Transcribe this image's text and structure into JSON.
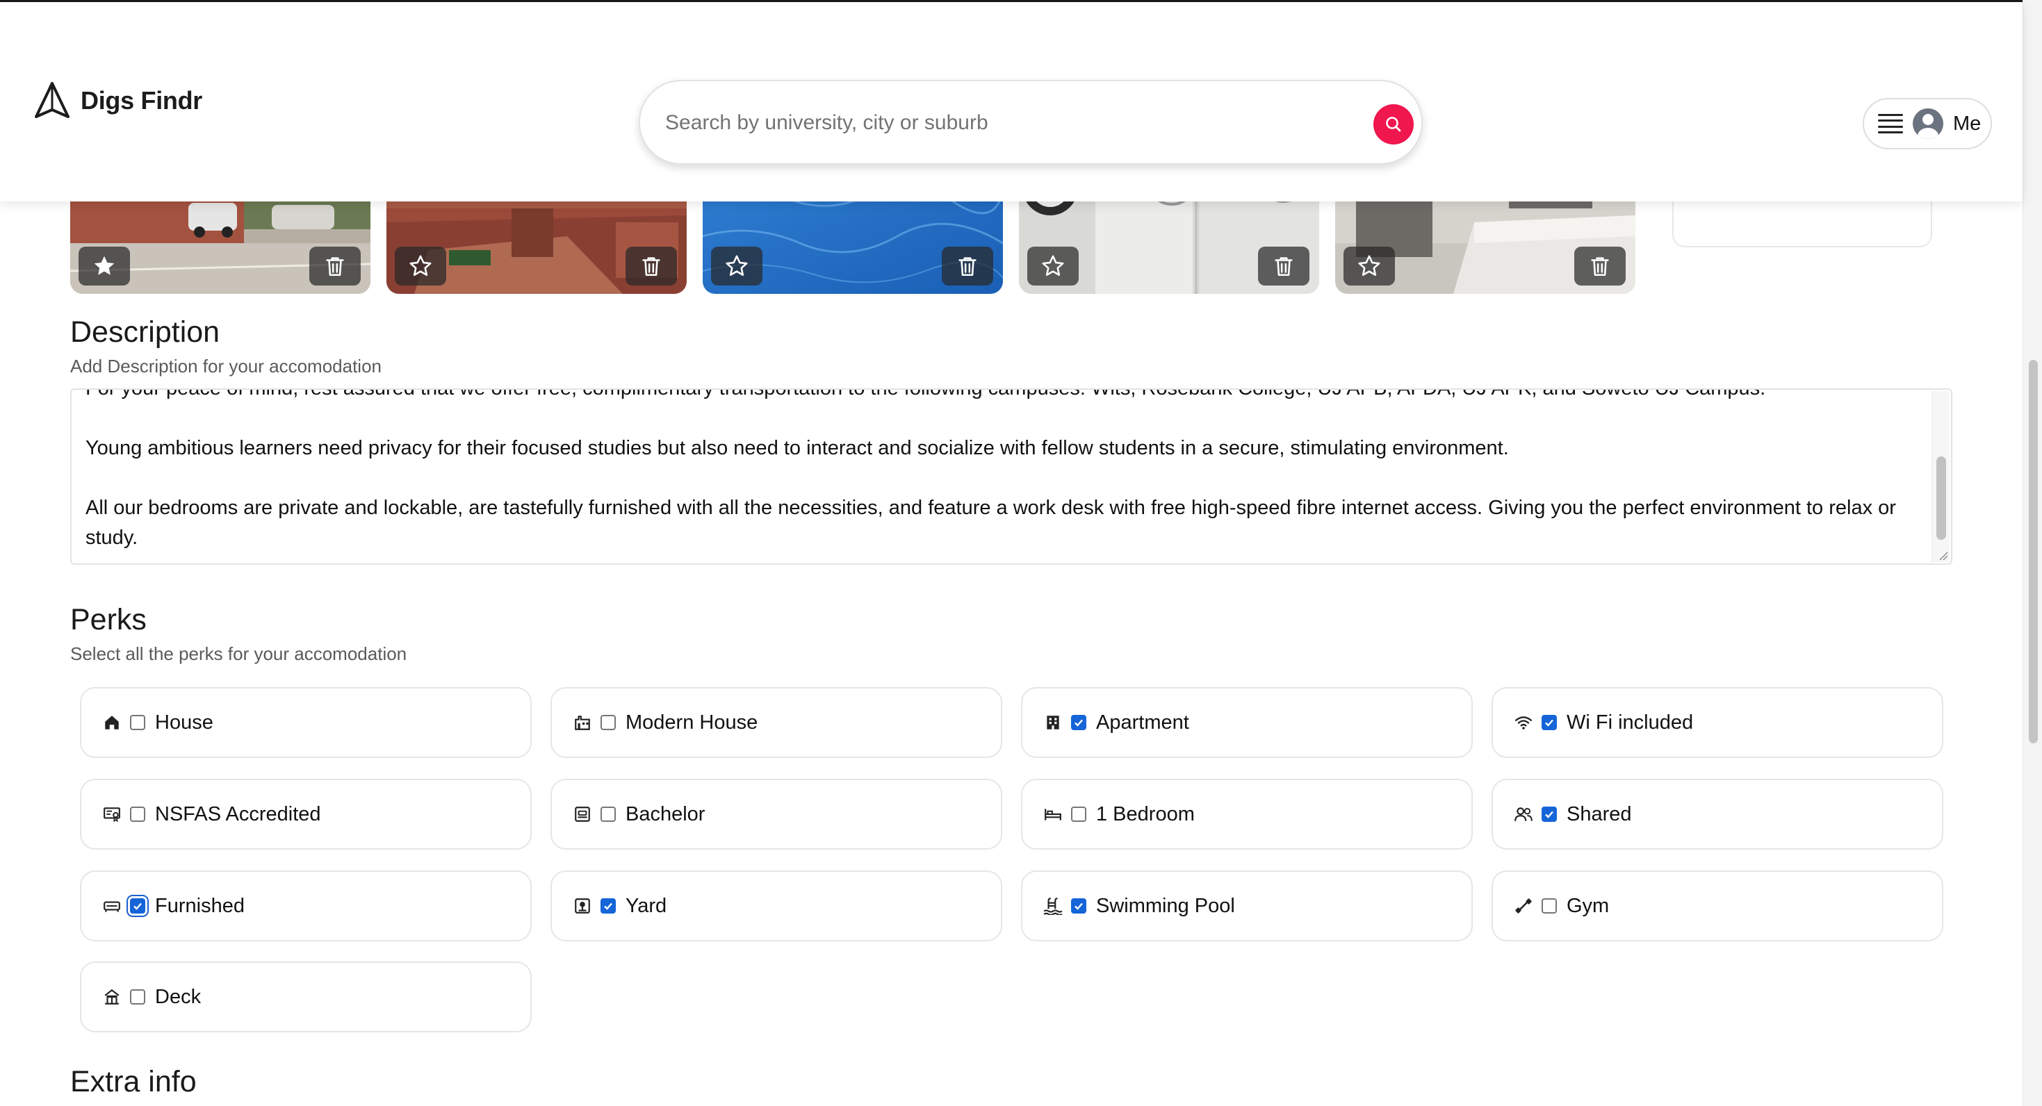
{
  "app": {
    "name": "Digs Findr"
  },
  "search": {
    "placeholder": "Search by university, city or suburb"
  },
  "user_menu": {
    "label": "Me"
  },
  "photos": [
    {
      "featured": true
    },
    {
      "featured": false
    },
    {
      "featured": false
    },
    {
      "featured": false
    },
    {
      "featured": false
    }
  ],
  "description": {
    "title": "Description",
    "subtitle": "Add Description for your accomodation",
    "paragraphs": [
      "For your peace of mind, rest assured that we offer free, complimentary transportation to the following campuses: Wits, Rosebank College, UJ APB, AFDA, UJ APK, and Soweto UJ Campus.",
      "Young ambitious learners need privacy for their focused studies but also need to interact and socialize with fellow students in a secure, stimulating environment.",
      "All our bedrooms are private and lockable, are tastefully furnished with all the necessities, and feature a work desk with free high-speed fibre internet access. Giving you the perfect environment to relax or study."
    ]
  },
  "perks": {
    "title": "Perks",
    "subtitle": "Select all the perks for your accomodation",
    "items": [
      {
        "label": "House",
        "icon": "house-icon",
        "checked": false
      },
      {
        "label": "Modern House",
        "icon": "modern-house-icon",
        "checked": false
      },
      {
        "label": "Apartment",
        "icon": "apartment-building-icon",
        "checked": true
      },
      {
        "label": "Wi Fi included",
        "icon": "wifi-icon",
        "checked": true
      },
      {
        "label": "NSFAS Accredited",
        "icon": "certificate-icon",
        "checked": false
      },
      {
        "label": "Bachelor",
        "icon": "bachelor-icon",
        "checked": false
      },
      {
        "label": "1 Bedroom",
        "icon": "bed-icon",
        "checked": false
      },
      {
        "label": "Shared",
        "icon": "users-icon",
        "checked": true
      },
      {
        "label": "Furnished",
        "icon": "sofa-icon",
        "checked": true
      },
      {
        "label": "Yard",
        "icon": "yard-icon",
        "checked": true
      },
      {
        "label": "Swimming Pool",
        "icon": "swimming-pool-icon",
        "checked": true
      },
      {
        "label": "Gym",
        "icon": "dumbbell-icon",
        "checked": false
      },
      {
        "label": "Deck",
        "icon": "deck-icon",
        "checked": false
      }
    ]
  },
  "extra_info": {
    "title": "Extra info"
  },
  "colors": {
    "accent": "#f0164e",
    "checkbox": "#1565d8"
  }
}
